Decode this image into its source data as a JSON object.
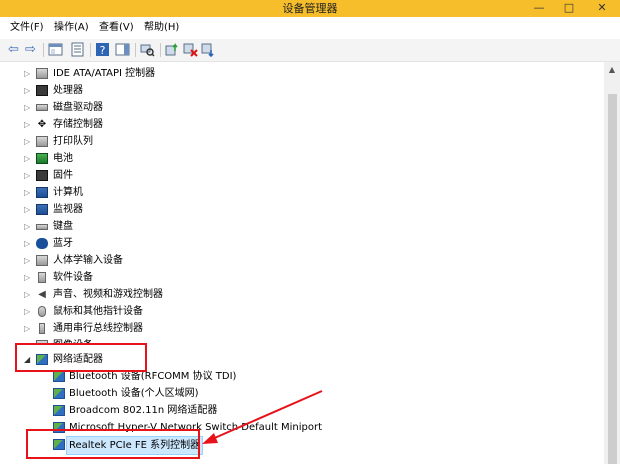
{
  "window": {
    "title": "设备管理器"
  },
  "window_controls": {
    "minimize": "—",
    "maximize": "□",
    "close": "✕"
  },
  "menu": [
    {
      "label": "文件(F)"
    },
    {
      "label": "操作(A)"
    },
    {
      "label": "查看(V)"
    },
    {
      "label": "帮助(H)"
    }
  ],
  "toolbar_icons": [
    "back-arrow-icon",
    "forward-arrow-icon",
    "show-hide-console-tree-icon",
    "properties-icon",
    "help-icon",
    "toggle-action-pane-icon",
    "scan-hardware-icon",
    "update-driver-icon",
    "uninstall-device-icon",
    "disable-device-icon"
  ],
  "tree": [
    {
      "label": "IDE ATA/ATAPI 控制器",
      "icon": "ide-controller-icon"
    },
    {
      "label": "处理器",
      "icon": "processor-icon"
    },
    {
      "label": "磁盘驱动器",
      "icon": "disk-drive-icon"
    },
    {
      "label": "存储控制器",
      "icon": "storage-controller-icon"
    },
    {
      "label": "打印队列",
      "icon": "printer-icon"
    },
    {
      "label": "电池",
      "icon": "battery-icon"
    },
    {
      "label": "固件",
      "icon": "firmware-icon"
    },
    {
      "label": "计算机",
      "icon": "computer-icon"
    },
    {
      "label": "监视器",
      "icon": "monitor-icon"
    },
    {
      "label": "键盘",
      "icon": "keyboard-icon"
    },
    {
      "label": "蓝牙",
      "icon": "bluetooth-icon"
    },
    {
      "label": "人体学输入设备",
      "icon": "hid-icon"
    },
    {
      "label": "软件设备",
      "icon": "software-device-icon"
    },
    {
      "label": "声音、视频和游戏控制器",
      "icon": "sound-icon"
    },
    {
      "label": "鼠标和其他指针设备",
      "icon": "mouse-icon"
    },
    {
      "label": "通用串行总线控制器",
      "icon": "usb-icon"
    },
    {
      "label": "图像设备",
      "icon": "imaging-device-icon"
    },
    {
      "label": "网络适配器",
      "icon": "network-adapter-icon",
      "expanded": true
    }
  ],
  "network_children": [
    {
      "label": "Bluetooth 设备(RFCOMM 协议 TDI)"
    },
    {
      "label": "Bluetooth 设备(个人区域网)"
    },
    {
      "label": "Broadcom 802.11n 网络适配器"
    },
    {
      "label": "Microsoft Hyper-V Network Switch Default Miniport"
    },
    {
      "label": "Realtek PCIe FE 系列控制器",
      "selected": true
    }
  ],
  "arrows": {
    "collapsed": "▷",
    "expanded": "◢",
    "scroll_up": "▲"
  }
}
